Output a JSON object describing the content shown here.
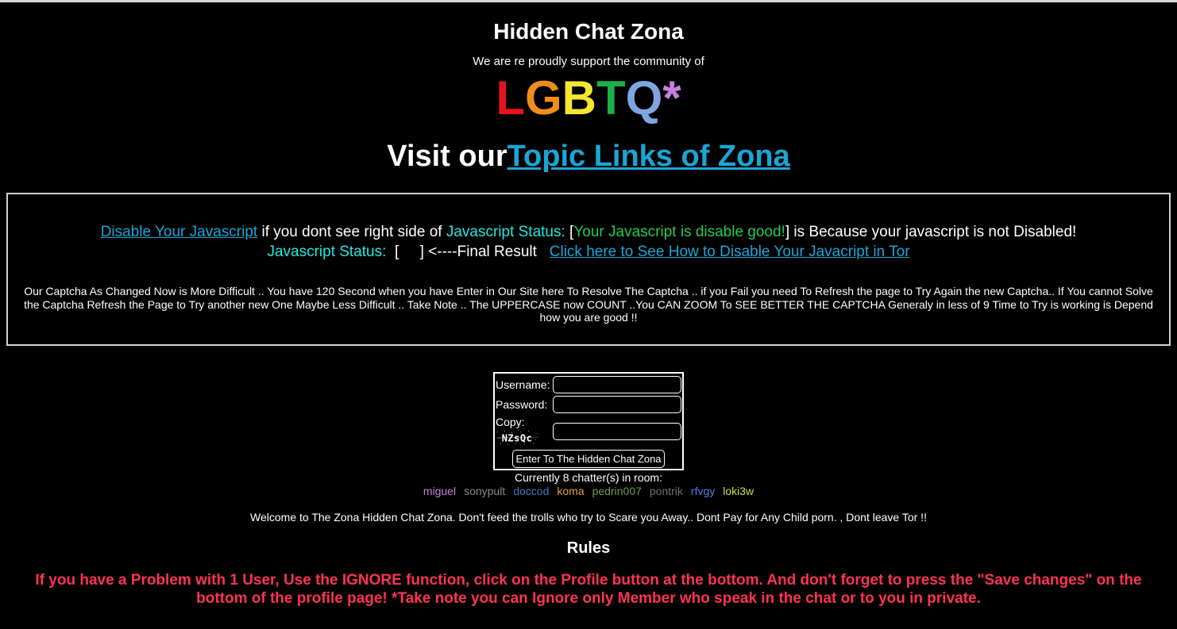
{
  "header": {
    "title": "Hidden Chat Zona",
    "support_text": "We are re proudly support the community of",
    "lgbtq": [
      {
        "char": "L",
        "color": "#e8121e"
      },
      {
        "char": "G",
        "color": "#f28c1b"
      },
      {
        "char": "B",
        "color": "#f5e632"
      },
      {
        "char": "T",
        "color": "#1fae4a"
      },
      {
        "char": "Q",
        "color": "#7fa6e0"
      },
      {
        "char": "*",
        "color": "#c77fe0"
      }
    ],
    "visit_prefix": "Visit our",
    "visit_link": "Topic Links of Zona"
  },
  "js_box": {
    "disable_link": "Disable Your Javascript",
    "line1_text": " if you dont see right side of ",
    "status_label": "Javascript Status:",
    "bracket_open": " [",
    "status_good": "Your Javascript is disable good!",
    "line1_tail": "] is Because your javascript is not Disabled!",
    "status_label2": "Javascript Status:",
    "final_result": "  [     ] <----Final Result   ",
    "howto_link": "Click here to See How to Disable Your Javacript in Tor",
    "captcha_note": "Our Captcha As Changed Now is More Difficult .. You have 120 Second when you have Enter in Our Site here To Resolve The Captcha .. if you Fail you need To Refresh the page to Try Again the new Captcha.. If You cannot Solve the Captcha Refresh the Page to Try another new One Maybe Less Difficult .. Take Note .. The UPPERCASE now COUNT ..You CAN ZOOM To SEE BETTER THE CAPTCHA Generaly in less of 9 Time to Try is working is Depend how you are good !!"
  },
  "login": {
    "username_label": "Username:",
    "password_label": "Password:",
    "copy_label": "Copy:",
    "captcha_text": "NZsQc",
    "submit_label": "Enter To The Hidden Chat Zona"
  },
  "room": {
    "chatters_text": "Currently 8 chatter(s) in room:",
    "names": [
      {
        "name": "miguel",
        "color": "#c77fe0"
      },
      {
        "name": "sonypult",
        "color": "#8a8a8a"
      },
      {
        "name": "doccod",
        "color": "#3a7fc0"
      },
      {
        "name": "koma",
        "color": "#e0a040"
      },
      {
        "name": "pedrin007",
        "color": "#6aa050"
      },
      {
        "name": "pontrik",
        "color": "#707060"
      },
      {
        "name": "rfvgy",
        "color": "#5080e0"
      },
      {
        "name": "loki3w",
        "color": "#c8e040"
      }
    ]
  },
  "welcome_text": "Welcome to The Zona Hidden Chat Zona. Don't feed the trolls who try to Scare you Away.. Dont Pay for Any Child porn. , Dont leave Tor !!",
  "rules": {
    "heading": "Rules",
    "red_rule": "If you have a Problem with 1 User, Use the IGNORE function, click on the Profile button at the bottom. And don't forget to press the \"Save changes\" on the bottom of the profile page! *Take note you can Ignore only Member who speak in the chat or to you in private."
  }
}
